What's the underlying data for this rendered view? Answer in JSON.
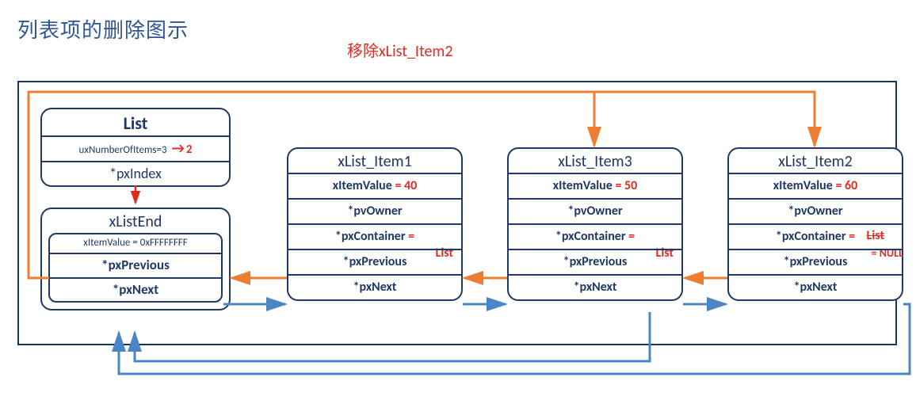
{
  "title": "列表项的删除图示",
  "subtitle": "移除xList_Item2",
  "list": {
    "header": "List",
    "uxNumberPrefix": "uxNumberOfItems=3",
    "uxNumberNew": "2",
    "pxIndex": "*pxIndex"
  },
  "listEnd": {
    "header": "xListEnd",
    "xItemValue": "xItemValue = 0xFFFFFFFF",
    "pxPrevious": "*pxPrevious",
    "pxNext": "*pxNext"
  },
  "items": [
    {
      "header": "xList_Item1",
      "xItemValueLabel": "xItemValue",
      "xItemValueVal": " = 40",
      "pvOwner": "*pvOwner",
      "pxContainerLabel": "*pxContainer",
      "pxContainerEq": " = ",
      "pxContainerVal": "List",
      "pxPrevious": "*pxPrevious",
      "pxNext": "*pxNext"
    },
    {
      "header": "xList_Item3",
      "xItemValueLabel": "xItemValue",
      "xItemValueVal": " = 50",
      "pvOwner": "*pvOwner",
      "pxContainerLabel": "*pxContainer",
      "pxContainerEq": " = ",
      "pxContainerVal": "List",
      "pxPrevious": "*pxPrevious",
      "pxNext": "*pxNext"
    },
    {
      "header": "xList_Item2",
      "xItemValueLabel": "xItemValue",
      "xItemValueVal": " = 60",
      "pvOwner": "*pvOwner",
      "pxContainerLabel": "*pxContainer",
      "pxContainerEq": " = ",
      "pxContainerVal": "List",
      "pxContainerNew": "= NULL",
      "pxPrevious": "*pxPrevious",
      "pxNext": "*pxNext"
    }
  ]
}
